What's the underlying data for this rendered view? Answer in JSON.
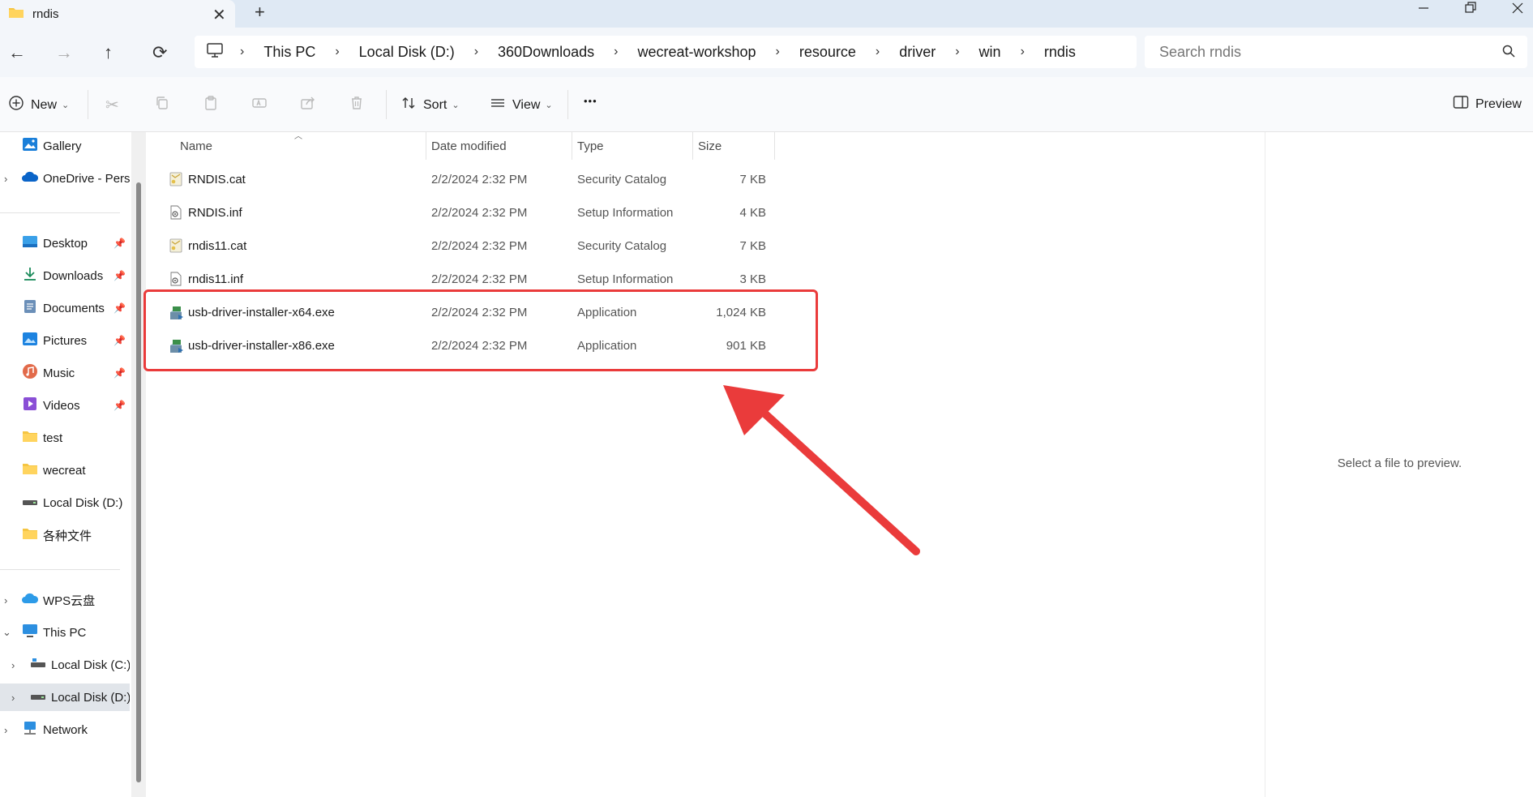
{
  "window": {
    "tab_title": "rndis",
    "new_tab": "+",
    "close_tab": "✕"
  },
  "navigation": {
    "back": "←",
    "forward": "→",
    "up": "↑",
    "refresh": "⟳",
    "breadcrumbs": [
      "This PC",
      "Local Disk (D:)",
      "360Downloads",
      "wecreat-workshop",
      "resource",
      "driver",
      "win",
      "rndis"
    ],
    "search_placeholder": "Search rndis"
  },
  "toolbar": {
    "new_label": "New",
    "sort_label": "Sort",
    "view_label": "View",
    "more_label": "•••",
    "preview_label": "Preview"
  },
  "sidebar": {
    "items": [
      {
        "label": "Gallery",
        "icon": "gallery-icon"
      },
      {
        "label": "OneDrive - Personal",
        "icon": "cloud-icon",
        "expandable": true
      },
      {
        "label": "Desktop",
        "icon": "desktop-icon",
        "pinned": true
      },
      {
        "label": "Downloads",
        "icon": "download-icon",
        "pinned": true
      },
      {
        "label": "Documents",
        "icon": "document-icon",
        "pinned": true
      },
      {
        "label": "Pictures",
        "icon": "pictures-icon",
        "pinned": true
      },
      {
        "label": "Music",
        "icon": "music-icon",
        "pinned": true
      },
      {
        "label": "Videos",
        "icon": "videos-icon",
        "pinned": true
      },
      {
        "label": "test",
        "icon": "folder-icon"
      },
      {
        "label": "wecreat",
        "icon": "folder-icon"
      },
      {
        "label": "Local Disk (D:)",
        "icon": "drive-icon"
      },
      {
        "label": "各种文件",
        "icon": "folder-icon"
      },
      {
        "label": "WPS云盘",
        "icon": "cloud-icon",
        "expandable": true
      },
      {
        "label": "This PC",
        "icon": "pc-icon",
        "expanded": true
      },
      {
        "label": "Local Disk (C:)",
        "icon": "drive-icon",
        "expandable": true
      },
      {
        "label": "Local Disk (D:)",
        "icon": "drive-icon",
        "expandable": true,
        "selected": true
      },
      {
        "label": "Network",
        "icon": "network-icon",
        "expandable": true
      }
    ]
  },
  "file_list": {
    "columns": [
      "Name",
      "Date modified",
      "Type",
      "Size"
    ],
    "rows": [
      {
        "name": "RNDIS.cat",
        "date": "2/2/2024 2:32 PM",
        "type": "Security Catalog",
        "size": "7 KB",
        "icon": "catalog-icon"
      },
      {
        "name": "RNDIS.inf",
        "date": "2/2/2024 2:32 PM",
        "type": "Setup Information",
        "size": "4 KB",
        "icon": "setup-info-icon"
      },
      {
        "name": "rndis11.cat",
        "date": "2/2/2024 2:32 PM",
        "type": "Security Catalog",
        "size": "7 KB",
        "icon": "catalog-icon"
      },
      {
        "name": "rndis11.inf",
        "date": "2/2/2024 2:32 PM",
        "type": "Setup Information",
        "size": "3 KB",
        "icon": "setup-info-icon"
      },
      {
        "name": "usb-driver-installer-x64.exe",
        "date": "2/2/2024 2:32 PM",
        "type": "Application",
        "size": "1,024 KB",
        "icon": "installer-icon"
      },
      {
        "name": "usb-driver-installer-x86.exe",
        "date": "2/2/2024 2:32 PM",
        "type": "Application",
        "size": "901 KB",
        "icon": "installer-icon"
      }
    ]
  },
  "preview_pane": {
    "message": "Select a file to preview."
  },
  "colors": {
    "annotation_red": "#ea3b3b",
    "titlebar": "#dfe9f4",
    "navbar": "#f3f6fa",
    "selected": "#e1e5ea"
  }
}
